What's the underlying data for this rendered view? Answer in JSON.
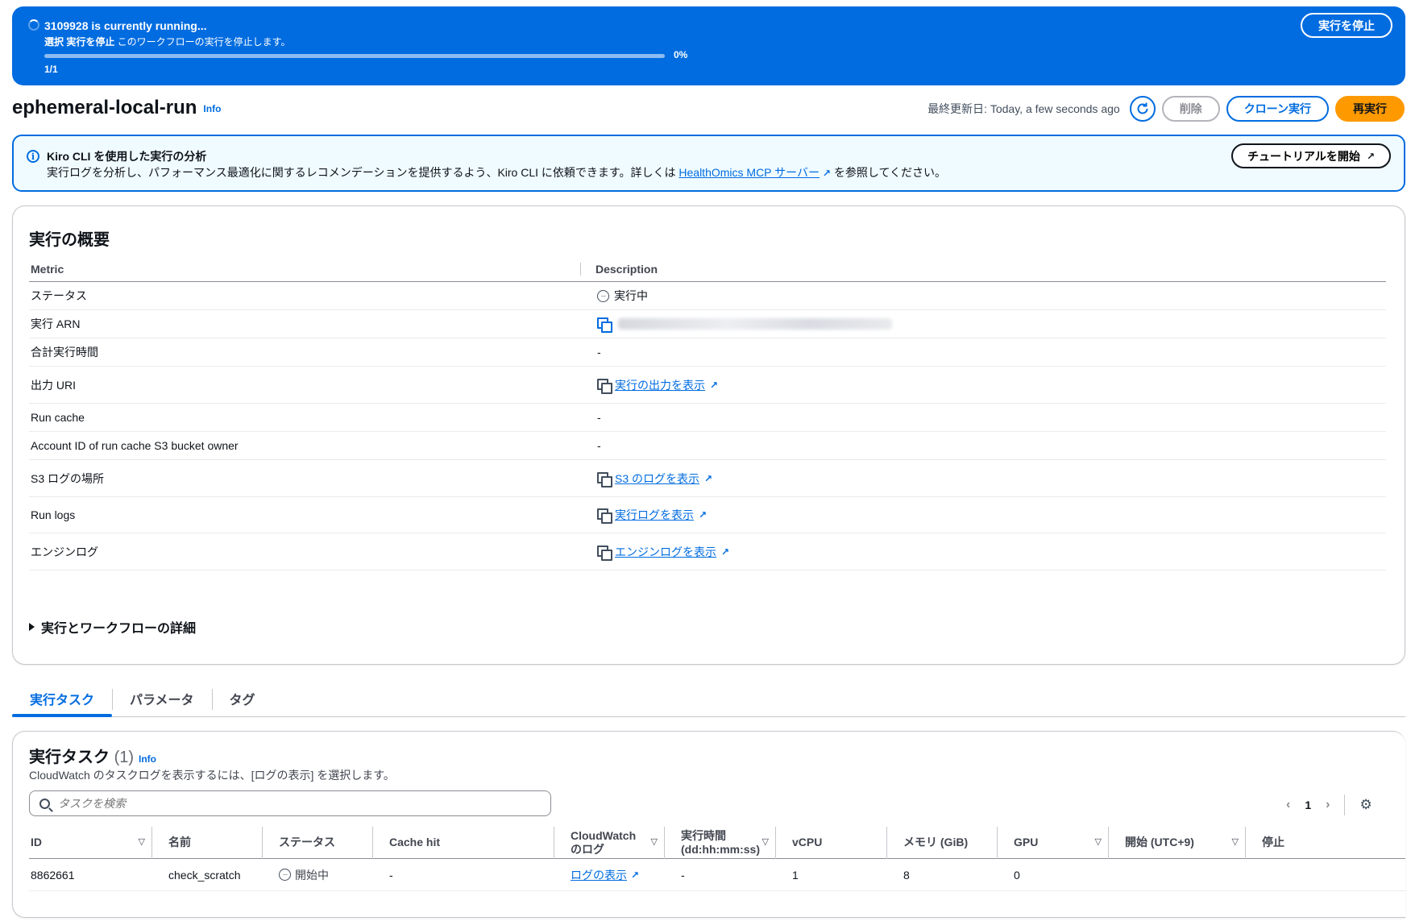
{
  "flash": {
    "title": "3109928 is currently running...",
    "sub_bold": "選択 実行を停止",
    "sub_rest": " このワークフローの実行を停止します。",
    "progress_percent": 0,
    "progress_label": "0%",
    "count": "1/1",
    "stop_button": "実行を停止"
  },
  "header": {
    "title": "ephemeral-local-run",
    "info": "Info",
    "last_updated": "最終更新日: Today, a few seconds ago",
    "delete_button": "削除",
    "clone_button": "クローン実行",
    "rerun_button": "再実行"
  },
  "alert": {
    "title": "Kiro CLI を使用した実行の分析",
    "body_before": "実行ログを分析し、パフォーマンス最適化に関するレコメンデーションを提供するよう、Kiro CLI に依頼できます。詳しくは ",
    "body_link": "HealthOmics MCP サーバー",
    "body_after": " を参照してください。",
    "tutorial_button": "チュートリアルを開始"
  },
  "overview": {
    "title": "実行の概要",
    "col_metric": "Metric",
    "col_description": "Description",
    "rows": [
      {
        "key": "ステータス",
        "value": "実行中"
      },
      {
        "key": "実行 ARN",
        "value": ""
      },
      {
        "key": "合計実行時間",
        "value": "-"
      },
      {
        "key": "出力 URI",
        "value": "実行の出力を表示"
      },
      {
        "key": "Run cache",
        "value": "-"
      },
      {
        "key": "Account ID of run cache S3 bucket owner",
        "value": "-"
      },
      {
        "key": "S3 ログの場所",
        "value": "S3 のログを表示"
      },
      {
        "key": "Run logs",
        "value": "実行ログを表示"
      },
      {
        "key": "エンジンログ",
        "value": "エンジンログを表示"
      }
    ],
    "expander": "実行とワークフローの詳細"
  },
  "tabs": [
    {
      "label": "実行タスク",
      "active": true
    },
    {
      "label": "パラメータ",
      "active": false
    },
    {
      "label": "タグ",
      "active": false
    }
  ],
  "tasks": {
    "title": "実行タスク",
    "count": "(1)",
    "info": "Info",
    "description": "CloudWatch のタスクログを表示するには、[ログの表示] を選択します。",
    "search_placeholder": "タスクを検索",
    "page": "1",
    "columns": [
      "ID",
      "名前",
      "ステータス",
      "Cache hit",
      "CloudWatch\nのログ",
      "実行時間\n(dd:hh:mm:ss)",
      "vCPU",
      "メモリ (GiB)",
      "GPU",
      "開始 (UTC+9)",
      "停止"
    ],
    "rows": [
      {
        "id": "8862661",
        "name": "check_scratch",
        "status": "開始中",
        "cache_hit": "-",
        "logs": "ログの表示",
        "duration": "-",
        "vcpu": "1",
        "memory": "8",
        "gpu": "0"
      }
    ]
  },
  "colors": {
    "primary_blue": "#006ce0",
    "orange": "#ff9900",
    "alert_bg": "#f0fbff"
  }
}
